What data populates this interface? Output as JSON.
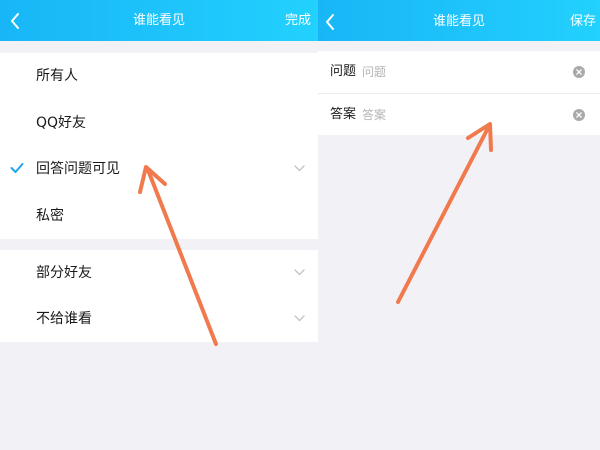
{
  "left_screen": {
    "header": {
      "title": "谁能看见",
      "action_label": "完成"
    },
    "options_group_1": [
      {
        "label": "所有人",
        "selected": false,
        "has_chevron": false
      },
      {
        "label": "QQ好友",
        "selected": false,
        "has_chevron": false
      },
      {
        "label": "回答问题可见",
        "selected": true,
        "has_chevron": true
      },
      {
        "label": "私密",
        "selected": false,
        "has_chevron": false
      }
    ],
    "options_group_2": [
      {
        "label": "部分好友",
        "has_chevron": true
      },
      {
        "label": "不给谁看",
        "has_chevron": true
      }
    ]
  },
  "right_screen": {
    "header": {
      "title": "谁能看见",
      "action_label": "保存"
    },
    "fields": [
      {
        "label": "问题",
        "placeholder": "问题",
        "value": ""
      },
      {
        "label": "答案",
        "placeholder": "答案",
        "value": ""
      }
    ]
  },
  "colors": {
    "header_gradient_start": "#18b6f6",
    "header_gradient_end": "#22d1fd",
    "check_accent": "#1ea6ec",
    "annotation_arrow": "#f07a4e",
    "background": "#f2f2f6"
  },
  "icons": {
    "back": "chevron-left-icon",
    "selected": "check-icon",
    "expand": "chevron-down-icon",
    "clear": "clear-circle-icon"
  }
}
